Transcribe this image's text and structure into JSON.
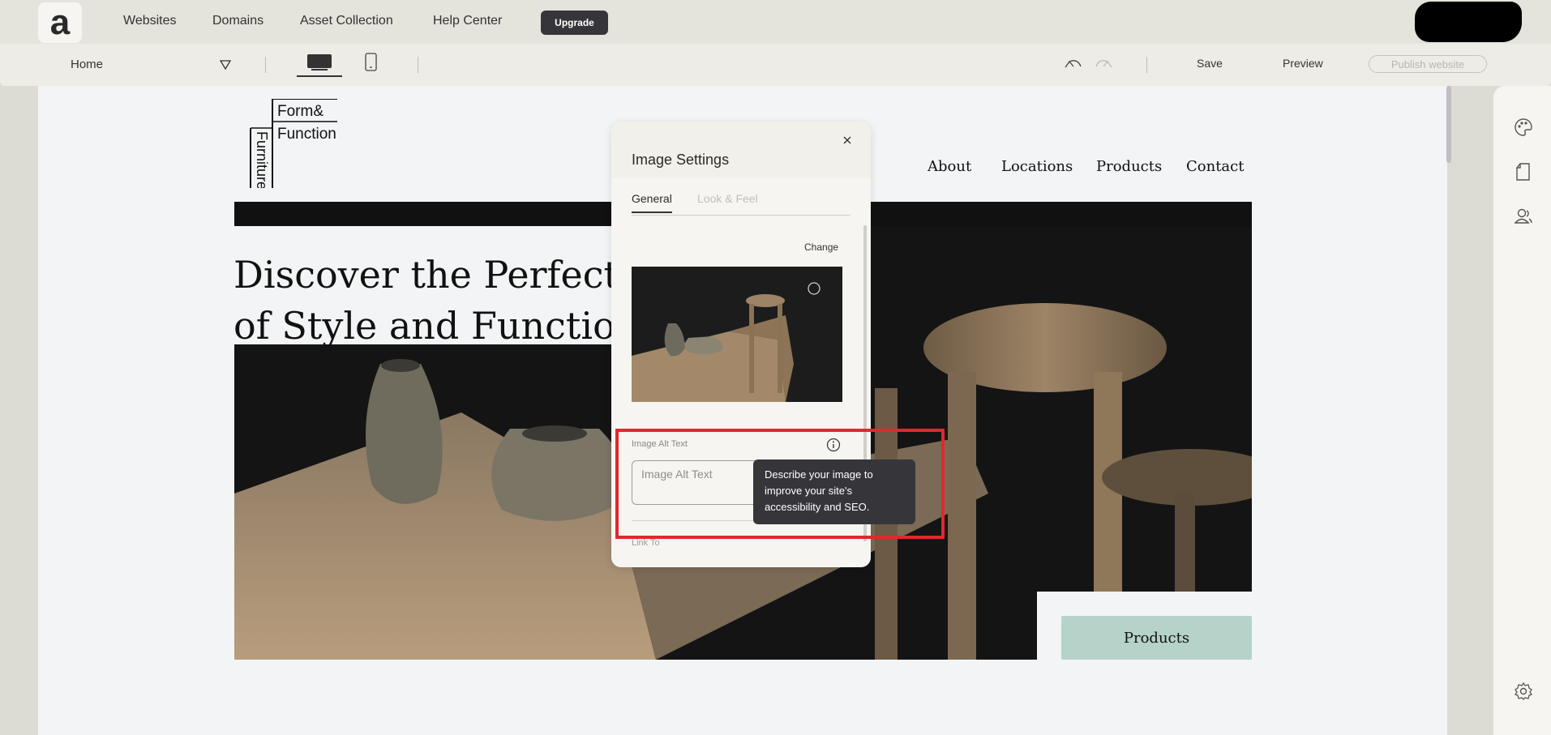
{
  "topbar": {
    "logo": "a",
    "nav": [
      "Websites",
      "Domains",
      "Asset Collection",
      "Help Center"
    ],
    "upgrade_label": "Upgrade"
  },
  "toolbar": {
    "page": "Home",
    "save_label": "Save",
    "preview_label": "Preview",
    "publish_label": "Publish website"
  },
  "site": {
    "logo_lines": [
      "Form&",
      "Function",
      "Furniture"
    ],
    "nav": [
      "About",
      "Locations",
      "Products",
      "Contact"
    ],
    "hero_line1": "Discover the Perfect Blend",
    "hero_line2": "of Style and Function",
    "products_button": "Products"
  },
  "dialog": {
    "title": "Image Settings",
    "tabs": [
      "General",
      "Look & Feel"
    ],
    "change_label": "Change",
    "alt_label": "Image Alt Text",
    "alt_placeholder": "Image Alt Text",
    "alt_value": "",
    "link_label": "Link To",
    "tooltip": "Describe your image to improve your site's accessibility and SEO."
  },
  "colors": {
    "accent_button": "#b5d3c8",
    "highlight": "#e0282e",
    "upgrade_bg": "#36363a"
  },
  "icons": {
    "right_panel": [
      "palette-icon",
      "page-icon",
      "users-icon",
      "gear-icon"
    ],
    "toolbar": [
      "undo-icon",
      "redo-icon",
      "desktop-icon",
      "mobile-icon"
    ]
  }
}
